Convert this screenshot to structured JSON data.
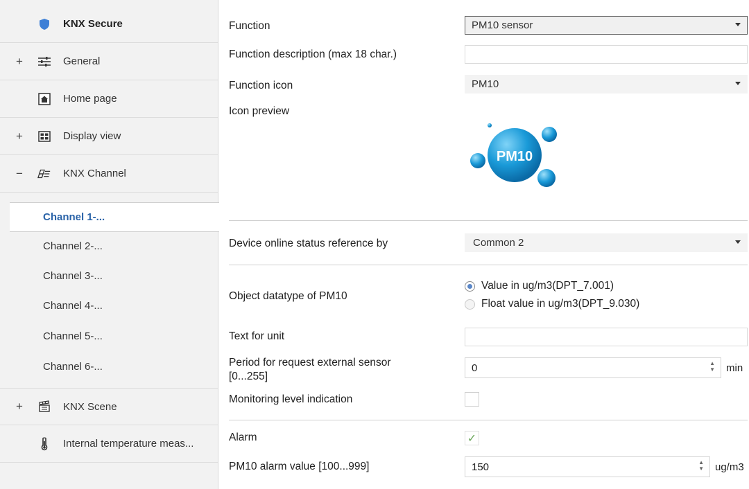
{
  "sidebar": {
    "items": [
      {
        "label": "KNX Secure",
        "expander": "",
        "icon": "shield-icon"
      },
      {
        "label": "General",
        "expander": "+",
        "icon": "sliders-icon"
      },
      {
        "label": "Home page",
        "expander": "",
        "icon": "home-icon"
      },
      {
        "label": "Display view",
        "expander": "+",
        "icon": "display-grid-icon"
      },
      {
        "label": "KNX Channel",
        "expander": "−",
        "icon": "channel-icon"
      }
    ],
    "channels": [
      "Channel 1-...",
      "Channel 2-...",
      "Channel 3-...",
      "Channel 4-...",
      "Channel 5-...",
      "Channel 6-..."
    ],
    "bottom_items": [
      {
        "label": "KNX Scene",
        "expander": "+",
        "icon": "scene-clapper-icon"
      },
      {
        "label": "Internal temperature meas...",
        "expander": "",
        "icon": "thermometer-icon"
      }
    ]
  },
  "main": {
    "function": {
      "label": "Function",
      "value": "PM10 sensor"
    },
    "function_description": {
      "label": "Function description (max 18 char.)",
      "value": ""
    },
    "function_icon": {
      "label": "Function icon",
      "value": "PM10"
    },
    "icon_preview": {
      "label": "Icon preview",
      "badge_text": "PM10"
    },
    "device_online": {
      "label": "Device online status reference by",
      "value": "Common 2"
    },
    "object_datatype": {
      "label": "Object datatype of PM10",
      "options": [
        "Value in ug/m3(DPT_7.001)",
        "Float value in ug/m3(DPT_9.030)"
      ],
      "selected_index": 0
    },
    "text_for_unit": {
      "label": "Text for unit",
      "value": ""
    },
    "period_request": {
      "label_line1": "Period for request external sensor",
      "label_line2": "[0...255]",
      "value": "0",
      "unit": "min"
    },
    "monitoring": {
      "label": "Monitoring level indication",
      "checked": false
    },
    "alarm": {
      "label": "Alarm",
      "checked": true,
      "check_glyph": "✓"
    },
    "alarm_value": {
      "label": "PM10 alarm value [100...999]",
      "value": "150",
      "unit": "ug/m3"
    }
  },
  "colors": {
    "accent_blue": "#2a63a8",
    "bubble": "#1a9ad8",
    "check_green": "#6aa65a"
  }
}
